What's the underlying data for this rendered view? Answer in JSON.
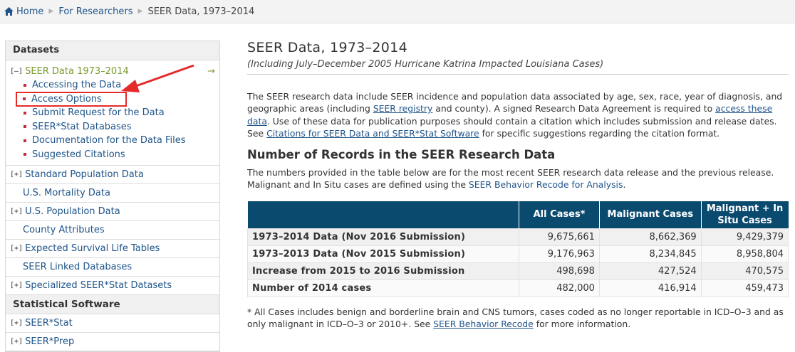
{
  "breadcrumb": {
    "home": "Home",
    "researchers": "For Researchers",
    "current": "SEER Data, 1973–2014"
  },
  "sidebar": {
    "datasets_header": "Datasets",
    "seer_data_group": {
      "expander": "[–]",
      "label": "SEER Data 1973–2014",
      "arrow": "→",
      "items": [
        "Accessing the Data",
        "Access Options",
        "Submit Request for the Data",
        "SEER*Stat Databases",
        "Documentation for the Data Files",
        "Suggested Citations"
      ]
    },
    "rows": [
      {
        "expander": "[+]",
        "label": "Standard Population Data"
      },
      {
        "expander": "",
        "label": "U.S. Mortality Data"
      },
      {
        "expander": "[+]",
        "label": "U.S. Population Data"
      },
      {
        "expander": "",
        "label": "County Attributes"
      },
      {
        "expander": "[+]",
        "label": "Expected Survival Life Tables"
      },
      {
        "expander": "",
        "label": "SEER Linked Databases"
      },
      {
        "expander": "[+]",
        "label": "Specialized SEER*Stat Datasets"
      }
    ],
    "software_header": "Statistical Software",
    "software_rows": [
      {
        "expander": "[+]",
        "label": "SEER*Stat"
      },
      {
        "expander": "[+]",
        "label": "SEER*Prep"
      }
    ]
  },
  "main": {
    "title": "SEER Data, 1973–2014",
    "subtitle": "(Including July–December 2005 Hurricane Katrina Impacted Louisiana Cases)",
    "intro": {
      "t1": "The SEER research data include SEER incidence and population data associated by age, sex, race, year of diagnosis, and geographic areas (including ",
      "link1": "SEER registry",
      "t2": " and county). A signed Research Data Agreement is required to ",
      "link2": "access these data",
      "t3": ". Use of these data for publication purposes should contain a citation which includes submission and release dates. See ",
      "link3": "Citations for SEER Data and SEER*Stat Software",
      "t4": " for specific suggestions regarding the citation format."
    },
    "section_title": "Number of Records in the SEER Research Data",
    "section_text": {
      "t1": "The numbers provided in the table below are for the most recent SEER research data release and the previous release. Malignant and In Situ cases are defined using the ",
      "link": "SEER Behavior Recode for Analysis",
      "t2": "."
    },
    "table": {
      "headers": [
        "",
        "All Cases*",
        "Malignant Cases",
        "Malignant + In Situ Cases"
      ],
      "rows": [
        {
          "label": "1973–2014 Data (Nov 2016 Submission)",
          "all": "9,675,661",
          "malignant": "8,662,369",
          "insitu": "9,429,379"
        },
        {
          "label": "1973–2013 Data (Nov 2015 Submission)",
          "all": "9,176,963",
          "malignant": "8,234,845",
          "insitu": "8,958,804"
        },
        {
          "label": "Increase from 2015 to 2016 Submission",
          "all": "498,698",
          "malignant": "427,524",
          "insitu": "470,575"
        },
        {
          "label": "Number of 2014 cases",
          "all": "482,000",
          "malignant": "416,914",
          "insitu": "459,473"
        }
      ]
    },
    "footnote": {
      "t1": "* All Cases includes benign and borderline brain and CNS tumors, cases coded as no longer reportable in ICD–O–3 and as only malignant in ICD–O–3 or 2010+. See ",
      "link": "SEER Behavior Recode",
      "t2": " for more information."
    }
  },
  "colors": {
    "link": "#20558a",
    "table_header": "#0b4a6f",
    "bullet": "#c8273d",
    "highlight": "#e52a2a",
    "active_group": "#7a9a2a"
  }
}
